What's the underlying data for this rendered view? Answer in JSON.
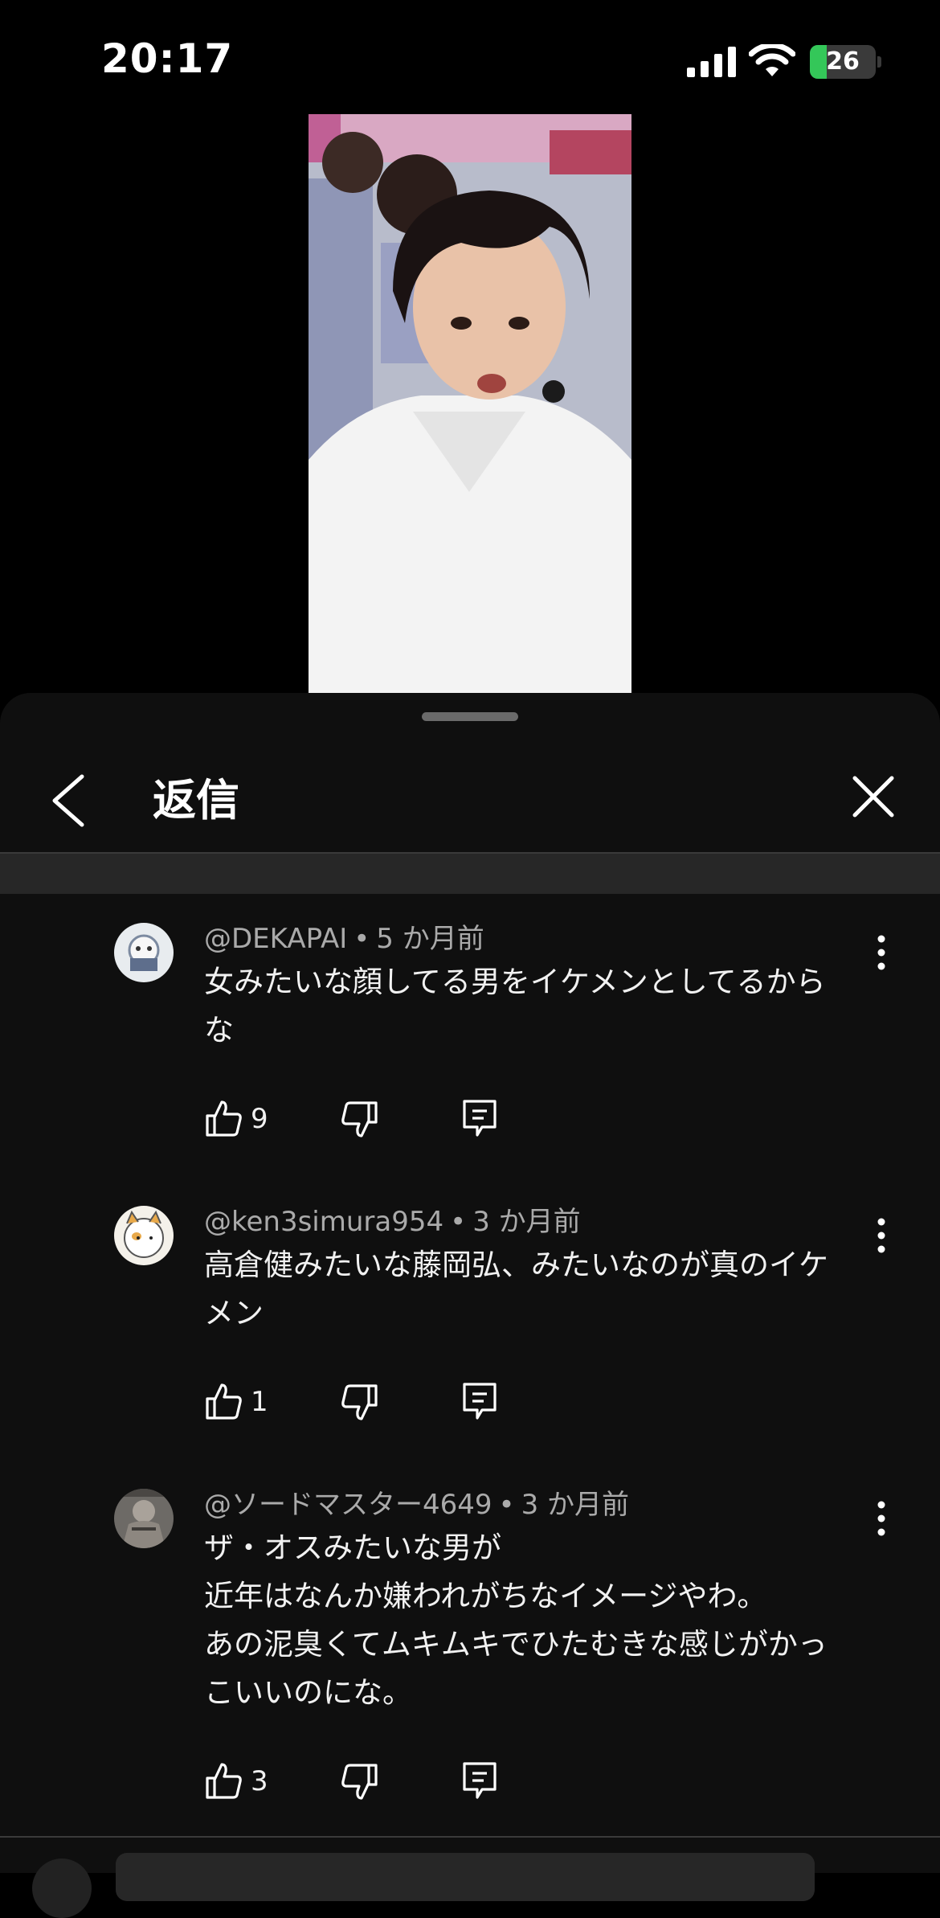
{
  "status_bar": {
    "time": "20:17",
    "battery": "26",
    "battery_level": 0.26
  },
  "sheet": {
    "title": "返信"
  },
  "comments": [
    {
      "handle": "@DEKAPAI",
      "separator": "•",
      "age": "5 か月前",
      "lines": [
        "女みたいな顔してる男をイケメンとしてるから",
        "な"
      ],
      "likes": "9"
    },
    {
      "handle": "@ken3simura954",
      "separator": "•",
      "age": "3 か月前",
      "lines": [
        "高倉健みたいな藤岡弘、みたいなのが真のイケ",
        "メン"
      ],
      "likes": "1"
    },
    {
      "handle": "@ソードマスター4649",
      "separator": "•",
      "age": "3 か月前",
      "lines": [
        "ザ・オスみたいな男が",
        "近年はなんか嫌われがちなイメージやわ。",
        "あの泥臭くてムキムキでひたむきな感じがかっ",
        "こいいのにな。"
      ],
      "likes": "3"
    }
  ],
  "icons": {
    "back": "chevron-left-icon",
    "close": "close-icon",
    "more": "more-vert-icon",
    "like": "thumb-up-icon",
    "dislike": "thumb-down-icon",
    "reply": "reply-comment-icon"
  },
  "colors": {
    "background": "#0f0f0f",
    "meta_text": "#aaaaaa",
    "battery_fill": "#34c759"
  }
}
